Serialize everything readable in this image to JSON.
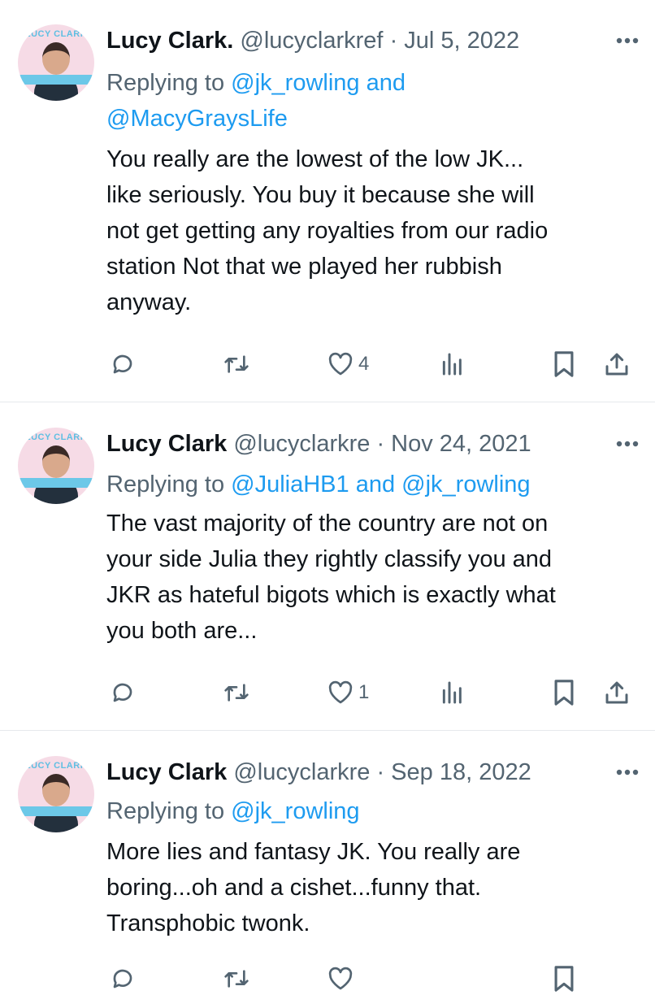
{
  "tweets": [
    {
      "avatar_brand": "LUCY CLARK",
      "name": "Lucy Clark.",
      "handle": "@lucyclarkref",
      "date": "· Jul 5, 2022",
      "replying_prefix": "Replying to",
      "replying_mentions_1": "@jk_rowling and",
      "replying_mentions_2": "@MacyGraysLife",
      "text_lines": [
        "You really are the lowest of the low JK...",
        "like seriously. You buy it because she will",
        "not get getting any royalties from our radio",
        "station  Not that we played her rubbish",
        "anyway."
      ],
      "like_count": "4"
    },
    {
      "avatar_brand": "LUCY CLARK",
      "name": "Lucy Clark",
      "handle": "@lucyclarkre",
      "date": "· Nov 24, 2021",
      "replying_prefix": "Replying to",
      "replying_mentions_1": "@JuliaHB1 and @jk_rowling",
      "text_lines": [
        "The vast majority of the country are not on",
        "your side Julia they rightly classify you and",
        "JKR as hateful bigots which is exactly what",
        "you both are..."
      ],
      "like_count": "1"
    },
    {
      "avatar_brand": "LUCY CLARK",
      "name": "Lucy Clark",
      "handle": "@lucyclarkre",
      "date": "· Sep 18, 2022",
      "replying_prefix": "Replying to",
      "replying_mentions_1": "@jk_rowling",
      "text_lines": [
        "More lies and fantasy JK.  You really are",
        "boring...oh and a cishet...funny that.",
        "Transphobic twonk."
      ]
    }
  ],
  "icons": {
    "more": "more-icon",
    "reply": "reply-icon",
    "retweet": "retweet-icon",
    "like": "heart-icon",
    "views": "views-icon",
    "bookmark": "bookmark-icon",
    "share": "share-icon"
  },
  "colors": {
    "text": "#0f1419",
    "secondary": "#536471",
    "link": "#1d9bf0",
    "divider": "#e6e9ec"
  }
}
